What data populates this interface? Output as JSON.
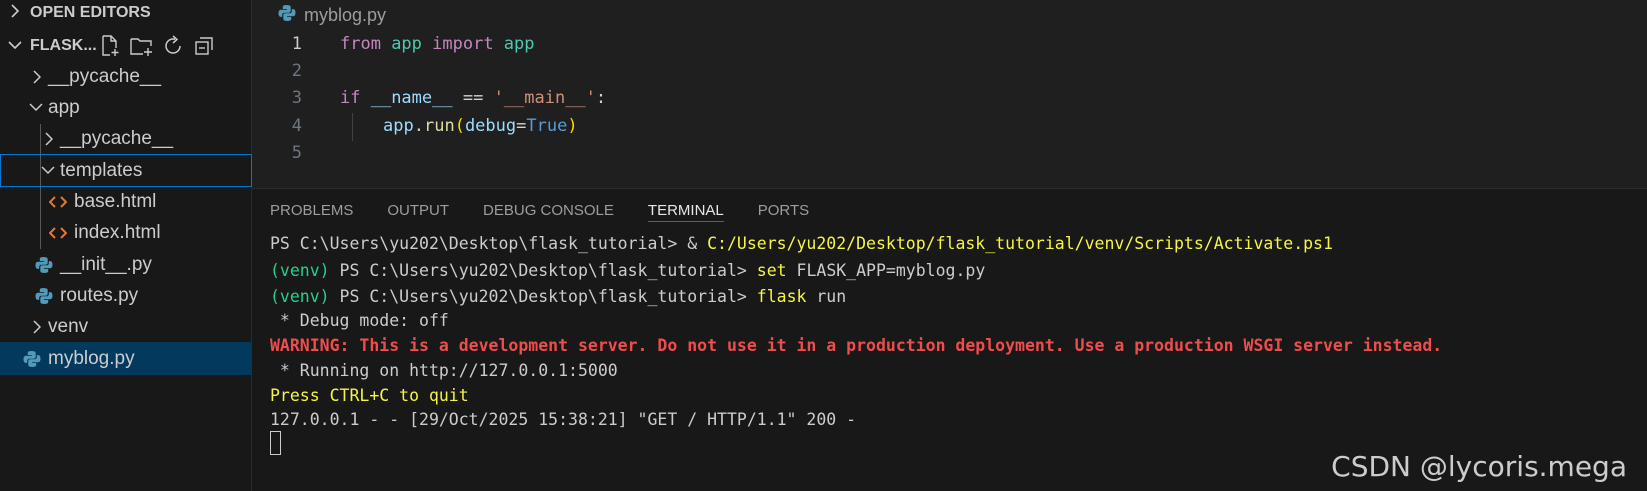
{
  "sidebar": {
    "open_editors": "OPEN EDITORS",
    "workspace": "FLASK...",
    "tree": [
      {
        "label": "__pycache__"
      },
      {
        "label": "app"
      },
      {
        "label": "__pycache__"
      },
      {
        "label": "templates"
      },
      {
        "label": "base.html"
      },
      {
        "label": "index.html"
      },
      {
        "label": "__init__.py"
      },
      {
        "label": "routes.py"
      },
      {
        "label": "venv"
      },
      {
        "label": "myblog.py"
      }
    ]
  },
  "editor": {
    "tab_title": "myblog.py",
    "line_numbers": [
      "1",
      "2",
      "3",
      "4",
      "5"
    ],
    "lines": [
      {
        "t1": "from",
        "t2": " app ",
        "t3": "import",
        "t4": " app"
      },
      {},
      {
        "t1": "if",
        "t2": " __name__",
        "t3": " == ",
        "t4": "'__main__'",
        "t5": ":"
      },
      {
        "t1": "app",
        "t2": ".",
        "t3": "run",
        "t4": "(",
        "t5": "debug",
        "t6": "=",
        "t7": "True",
        "t8": ")"
      },
      {}
    ]
  },
  "panel": {
    "tabs": [
      "PROBLEMS",
      "OUTPUT",
      "DEBUG CONSOLE",
      "TERMINAL",
      "PORTS"
    ],
    "terminal": {
      "l1_prompt": "PS C:\\Users\\yu202\\Desktop\\flask_tutorial> & ",
      "l1_cmd": "C:/Users/yu202/Desktop/flask_tutorial/venv/Scripts/Activate.ps1",
      "l2_venv": "(venv)",
      "l2_prompt": " PS C:\\Users\\yu202\\Desktop\\flask_tutorial> ",
      "l2_cmd": "set",
      "l2_arg": " FLASK_APP=myblog.py",
      "l3_venv": "(venv)",
      "l3_prompt": " PS C:\\Users\\yu202\\Desktop\\flask_tutorial> ",
      "l3_cmd": "flask",
      "l3_arg": " run",
      "l4": " * Debug mode: off",
      "l5": "WARNING: This is a development server. Do not use it in a production deployment. Use a production WSGI server instead.",
      "l6": " * Running on http://127.0.0.1:5000",
      "l7": "Press CTRL+C to quit",
      "l8": "127.0.0.1 - - [29/Oct/2025 15:38:21] \"GET / HTTP/1.1\" 200 -"
    }
  },
  "watermark": "CSDN @lycoris.mega",
  "colors": {
    "accent": "#0078d4",
    "selection": "#04395e",
    "python_icon": "#519aba",
    "html_icon": "#e37933"
  }
}
